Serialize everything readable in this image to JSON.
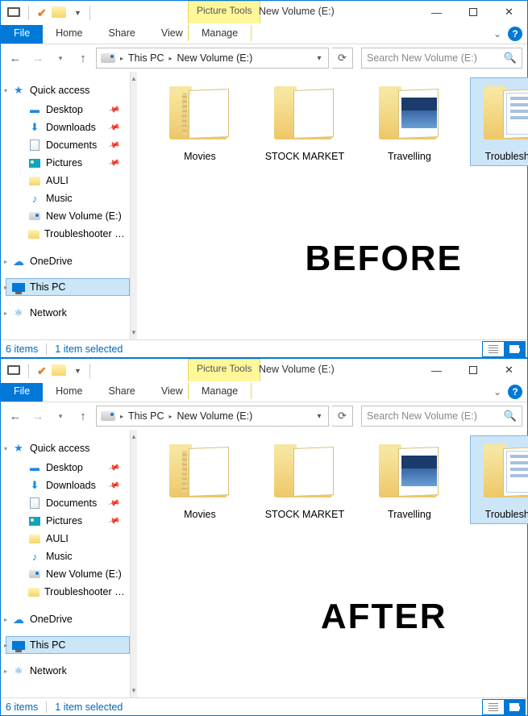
{
  "windows": [
    {
      "overlay": "BEFORE"
    },
    {
      "overlay": "AFTER"
    }
  ],
  "title": "New Volume (E:)",
  "picture_tools_label": "Picture Tools",
  "tabs": {
    "file": "File",
    "home": "Home",
    "share": "Share",
    "view": "View",
    "manage": "Manage"
  },
  "breadcrumb": {
    "root": "This PC",
    "current": "New Volume (E:)"
  },
  "search": {
    "placeholder": "Search New Volume (E:)"
  },
  "nav": {
    "quick_access": "Quick access",
    "desktop": "Desktop",
    "downloads": "Downloads",
    "documents": "Documents",
    "pictures": "Pictures",
    "auli": "AULI",
    "music": "Music",
    "new_volume": "New Volume (E:)",
    "troubleshooter": "Troubleshooter Wizard",
    "onedrive": "OneDrive",
    "this_pc": "This PC",
    "network": "Network"
  },
  "folders": [
    {
      "label": "Movies",
      "preview": "stripes"
    },
    {
      "label": "STOCK MARKET",
      "preview": "blank"
    },
    {
      "label": "Travelling",
      "preview": "photo"
    },
    {
      "label": "Troubleshoot",
      "preview": "document",
      "selected": true,
      "compressed": true
    }
  ],
  "status": {
    "count": "6 items",
    "selected": "1 item selected"
  }
}
